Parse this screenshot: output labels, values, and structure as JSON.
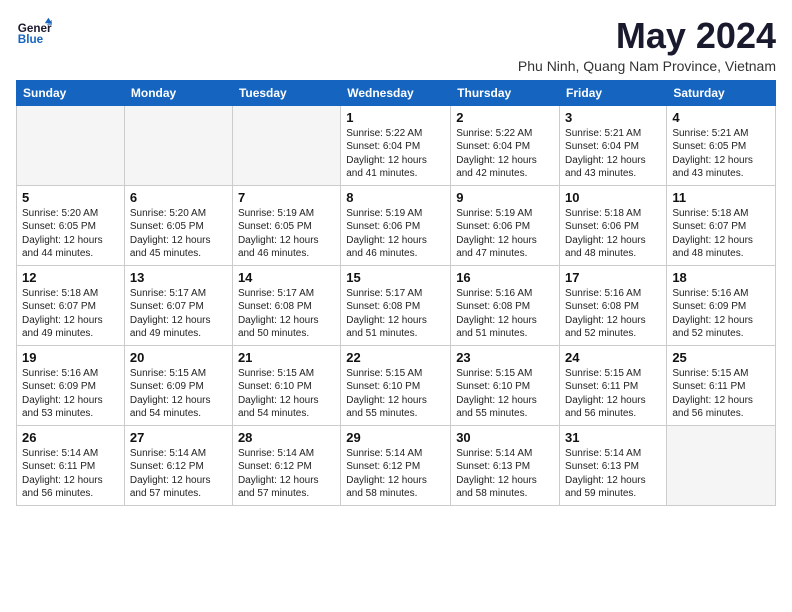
{
  "logo": {
    "line1": "General",
    "line2": "Blue"
  },
  "title": "May 2024",
  "subtitle": "Phu Ninh, Quang Nam Province, Vietnam",
  "days_of_week": [
    "Sunday",
    "Monday",
    "Tuesday",
    "Wednesday",
    "Thursday",
    "Friday",
    "Saturday"
  ],
  "weeks": [
    [
      {
        "day": "",
        "empty": true
      },
      {
        "day": "",
        "empty": true
      },
      {
        "day": "",
        "empty": true
      },
      {
        "day": "1",
        "sunrise": "5:22 AM",
        "sunset": "6:04 PM",
        "daylight": "12 hours and 41 minutes."
      },
      {
        "day": "2",
        "sunrise": "5:22 AM",
        "sunset": "6:04 PM",
        "daylight": "12 hours and 42 minutes."
      },
      {
        "day": "3",
        "sunrise": "5:21 AM",
        "sunset": "6:04 PM",
        "daylight": "12 hours and 43 minutes."
      },
      {
        "day": "4",
        "sunrise": "5:21 AM",
        "sunset": "6:05 PM",
        "daylight": "12 hours and 43 minutes."
      }
    ],
    [
      {
        "day": "5",
        "sunrise": "5:20 AM",
        "sunset": "6:05 PM",
        "daylight": "12 hours and 44 minutes."
      },
      {
        "day": "6",
        "sunrise": "5:20 AM",
        "sunset": "6:05 PM",
        "daylight": "12 hours and 45 minutes."
      },
      {
        "day": "7",
        "sunrise": "5:19 AM",
        "sunset": "6:05 PM",
        "daylight": "12 hours and 46 minutes."
      },
      {
        "day": "8",
        "sunrise": "5:19 AM",
        "sunset": "6:06 PM",
        "daylight": "12 hours and 46 minutes."
      },
      {
        "day": "9",
        "sunrise": "5:19 AM",
        "sunset": "6:06 PM",
        "daylight": "12 hours and 47 minutes."
      },
      {
        "day": "10",
        "sunrise": "5:18 AM",
        "sunset": "6:06 PM",
        "daylight": "12 hours and 48 minutes."
      },
      {
        "day": "11",
        "sunrise": "5:18 AM",
        "sunset": "6:07 PM",
        "daylight": "12 hours and 48 minutes."
      }
    ],
    [
      {
        "day": "12",
        "sunrise": "5:18 AM",
        "sunset": "6:07 PM",
        "daylight": "12 hours and 49 minutes."
      },
      {
        "day": "13",
        "sunrise": "5:17 AM",
        "sunset": "6:07 PM",
        "daylight": "12 hours and 49 minutes."
      },
      {
        "day": "14",
        "sunrise": "5:17 AM",
        "sunset": "6:08 PM",
        "daylight": "12 hours and 50 minutes."
      },
      {
        "day": "15",
        "sunrise": "5:17 AM",
        "sunset": "6:08 PM",
        "daylight": "12 hours and 51 minutes."
      },
      {
        "day": "16",
        "sunrise": "5:16 AM",
        "sunset": "6:08 PM",
        "daylight": "12 hours and 51 minutes."
      },
      {
        "day": "17",
        "sunrise": "5:16 AM",
        "sunset": "6:08 PM",
        "daylight": "12 hours and 52 minutes."
      },
      {
        "day": "18",
        "sunrise": "5:16 AM",
        "sunset": "6:09 PM",
        "daylight": "12 hours and 52 minutes."
      }
    ],
    [
      {
        "day": "19",
        "sunrise": "5:16 AM",
        "sunset": "6:09 PM",
        "daylight": "12 hours and 53 minutes."
      },
      {
        "day": "20",
        "sunrise": "5:15 AM",
        "sunset": "6:09 PM",
        "daylight": "12 hours and 54 minutes."
      },
      {
        "day": "21",
        "sunrise": "5:15 AM",
        "sunset": "6:10 PM",
        "daylight": "12 hours and 54 minutes."
      },
      {
        "day": "22",
        "sunrise": "5:15 AM",
        "sunset": "6:10 PM",
        "daylight": "12 hours and 55 minutes."
      },
      {
        "day": "23",
        "sunrise": "5:15 AM",
        "sunset": "6:10 PM",
        "daylight": "12 hours and 55 minutes."
      },
      {
        "day": "24",
        "sunrise": "5:15 AM",
        "sunset": "6:11 PM",
        "daylight": "12 hours and 56 minutes."
      },
      {
        "day": "25",
        "sunrise": "5:15 AM",
        "sunset": "6:11 PM",
        "daylight": "12 hours and 56 minutes."
      }
    ],
    [
      {
        "day": "26",
        "sunrise": "5:14 AM",
        "sunset": "6:11 PM",
        "daylight": "12 hours and 56 minutes."
      },
      {
        "day": "27",
        "sunrise": "5:14 AM",
        "sunset": "6:12 PM",
        "daylight": "12 hours and 57 minutes."
      },
      {
        "day": "28",
        "sunrise": "5:14 AM",
        "sunset": "6:12 PM",
        "daylight": "12 hours and 57 minutes."
      },
      {
        "day": "29",
        "sunrise": "5:14 AM",
        "sunset": "6:12 PM",
        "daylight": "12 hours and 58 minutes."
      },
      {
        "day": "30",
        "sunrise": "5:14 AM",
        "sunset": "6:13 PM",
        "daylight": "12 hours and 58 minutes."
      },
      {
        "day": "31",
        "sunrise": "5:14 AM",
        "sunset": "6:13 PM",
        "daylight": "12 hours and 59 minutes."
      },
      {
        "day": "",
        "empty": true
      }
    ]
  ],
  "labels": {
    "sunrise_prefix": "Sunrise: ",
    "sunset_prefix": "Sunset: ",
    "daylight_prefix": "Daylight: "
  }
}
